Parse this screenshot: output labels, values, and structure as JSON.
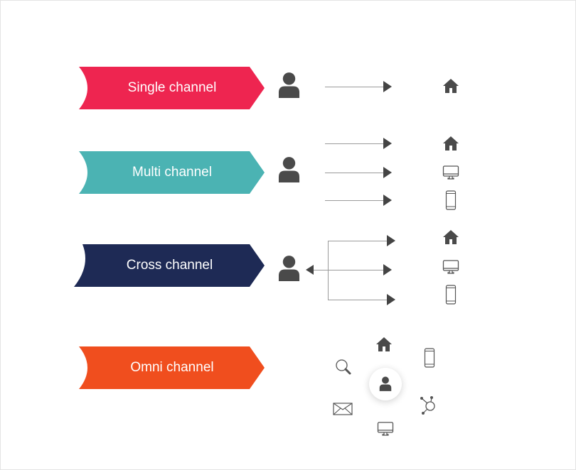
{
  "rows": [
    {
      "label": "Single channel",
      "color": "#ee2550"
    },
    {
      "label": "Multi channel",
      "color": "#4bb3b3"
    },
    {
      "label": "Cross channel",
      "color": "#1e2a55"
    },
    {
      "label": "Omni channel",
      "color": "#f04e1e"
    }
  ],
  "icons": {
    "person": "person-icon",
    "home": "home-icon",
    "monitor": "monitor-icon",
    "phone": "smartphone-icon",
    "search": "search-icon",
    "mail": "mail-icon",
    "network": "network-icon"
  }
}
